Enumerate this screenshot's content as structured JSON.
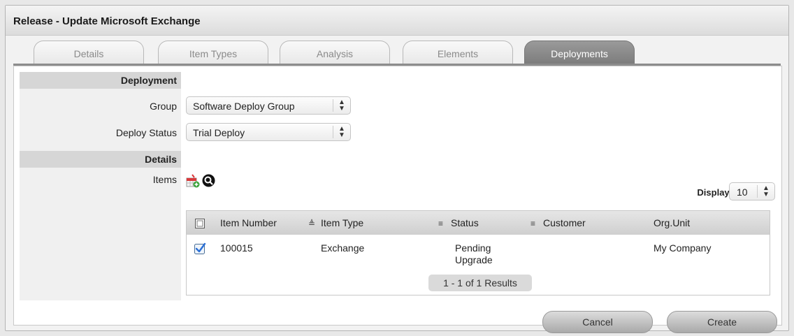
{
  "window": {
    "title": "Release - Update Microsoft Exchange"
  },
  "tabs": [
    {
      "label": "Details"
    },
    {
      "label": "Item Types"
    },
    {
      "label": "Analysis"
    },
    {
      "label": "Elements"
    },
    {
      "label": "Deployments",
      "active": true
    }
  ],
  "deployment": {
    "heading": "Deployment",
    "group_label": "Group",
    "group_value": "Software Deploy Group",
    "status_label": "Deploy Status",
    "status_value": "Trial Deploy"
  },
  "details": {
    "heading": "Details",
    "items_label": "Items",
    "add_icon": "add-item-icon",
    "search_icon": "search-icon",
    "display_label": "Display:",
    "display_value": "10"
  },
  "table": {
    "columns": [
      "Item Number",
      "Item Type",
      "Status",
      "Customer",
      "Org.Unit"
    ],
    "rows": [
      {
        "checked": true,
        "item_number": "100015",
        "item_type": "Exchange",
        "status_line1": "Pending",
        "status_line2": "Upgrade",
        "customer": "",
        "org_unit": "My Company"
      }
    ],
    "results": "1 - 1 of 1 Results"
  },
  "buttons": {
    "cancel": "Cancel",
    "create": "Create"
  },
  "colors": {
    "active_tab": "#8a8a8a",
    "check_blue": "#2a6fd6",
    "add_icon_red": "#d9383a",
    "add_icon_green": "#3aa13a"
  }
}
